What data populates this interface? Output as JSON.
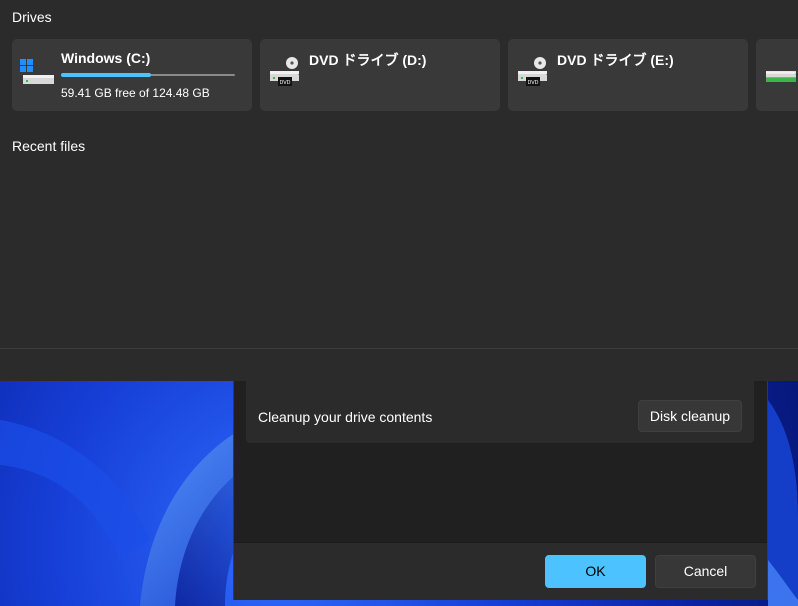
{
  "drives_section": {
    "title": "Drives"
  },
  "drives": [
    {
      "name": "Windows (C:)",
      "free_text": "59.41 GB free of 124.48 GB",
      "used_fraction": 0.52,
      "icon": "windows-drive-icon"
    },
    {
      "name": "DVD ドライブ (D:)",
      "free_text": "",
      "icon": "dvd-drive-icon"
    },
    {
      "name": "DVD ドライブ (E:)",
      "free_text": "",
      "icon": "dvd-drive-icon"
    },
    {
      "name": "",
      "free_text": "",
      "icon": "drive-icon"
    }
  ],
  "recent_section": {
    "title": "Recent files"
  },
  "dialog": {
    "cleanup_label": "Cleanup your drive contents",
    "cleanup_button": "Disk cleanup",
    "ok_button": "OK",
    "cancel_button": "Cancel"
  },
  "colors": {
    "accent": "#4cc2ff",
    "explorer_bg": "#2b2b2b",
    "card_bg": "#393939",
    "dialog_bg": "#202020"
  }
}
